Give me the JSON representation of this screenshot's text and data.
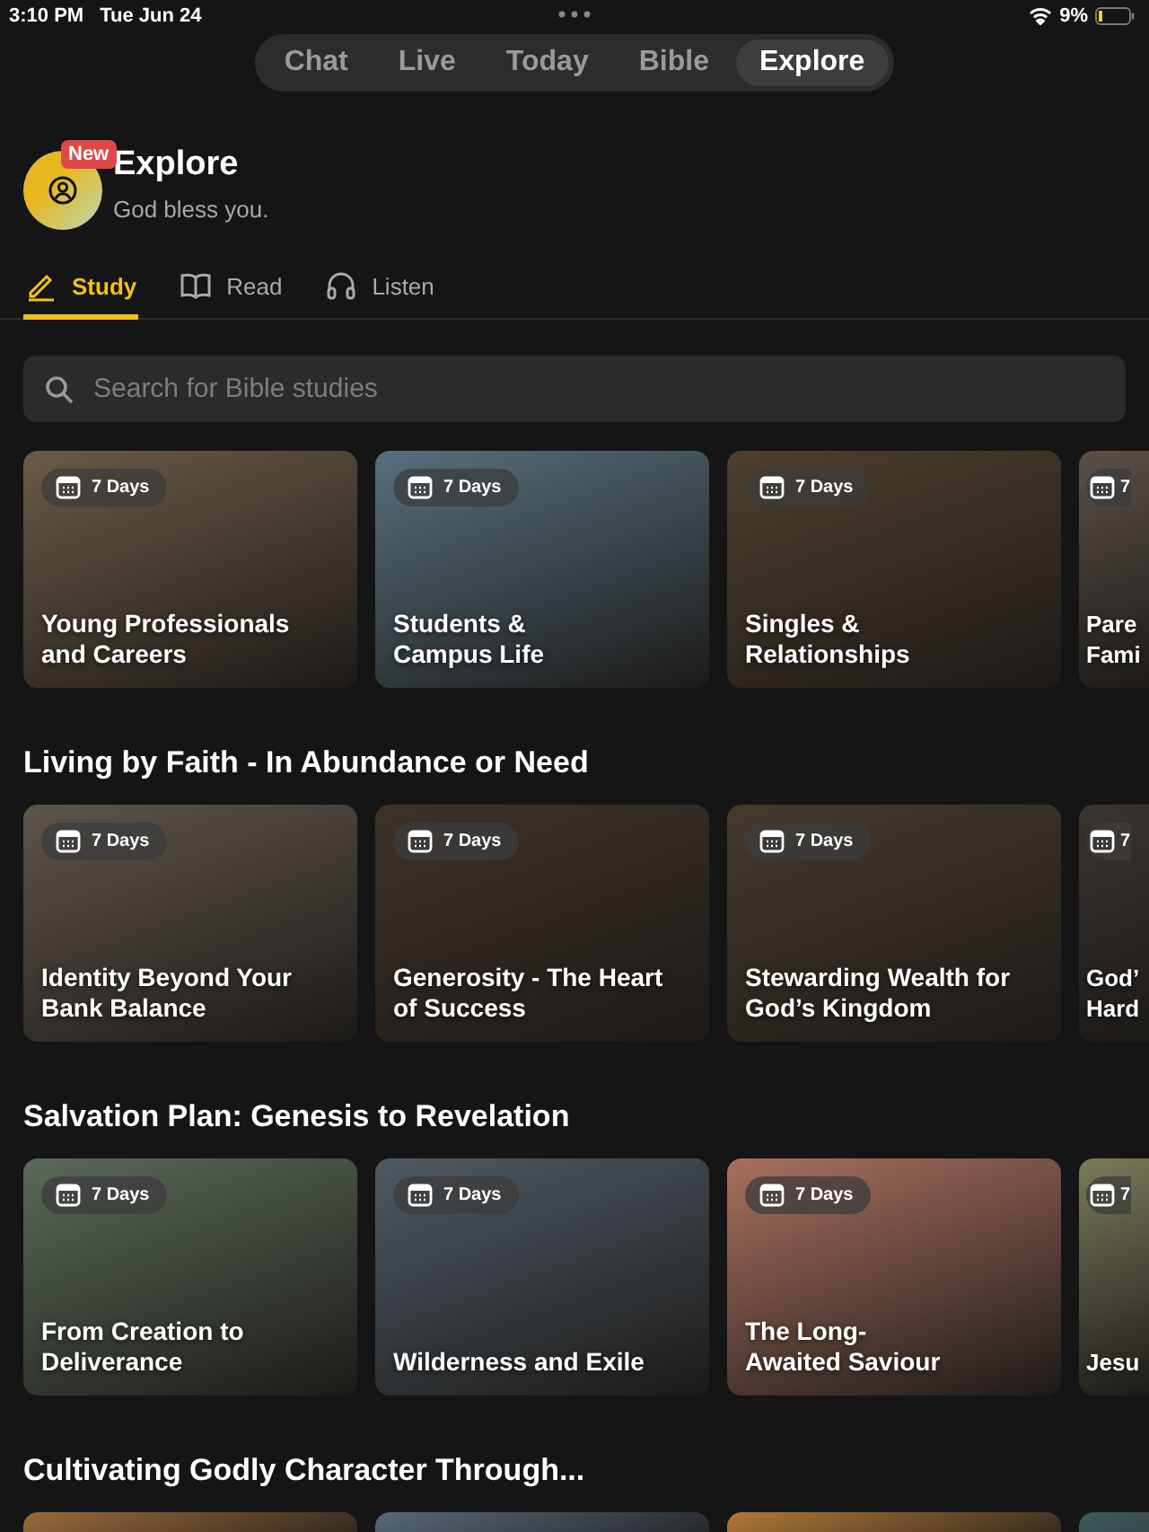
{
  "status_bar": {
    "time": "3:10 PM",
    "date": "Tue Jun 24",
    "battery": "9%"
  },
  "nav_tabs": [
    {
      "label": "Chat",
      "selected": false
    },
    {
      "label": "Live",
      "selected": false
    },
    {
      "label": "Today",
      "selected": false
    },
    {
      "label": "Bible",
      "selected": false
    },
    {
      "label": "Explore",
      "selected": true
    }
  ],
  "header": {
    "badge": "New",
    "title": "Explore",
    "subtitle": "God bless you."
  },
  "content_tabs": [
    {
      "label": "Study",
      "kind": "pencil",
      "selected": true
    },
    {
      "label": "Read",
      "kind": "book",
      "selected": false
    },
    {
      "label": "Listen",
      "kind": "headphones",
      "selected": false
    }
  ],
  "search": {
    "placeholder": "Search for Bible studies"
  },
  "sections": [
    {
      "cards": [
        {
          "kind": "full",
          "badge": "7 Days",
          "title": "Young Professionals\nand Careers",
          "color": "#6b5a45"
        },
        {
          "kind": "full",
          "badge": "7 Days",
          "title": "Students &\nCampus Life",
          "color": "#56707e"
        },
        {
          "kind": "full",
          "badge": "7 Days",
          "title": "Singles &\nRelationships",
          "color": "#4e3f2c"
        },
        {
          "kind": "cut",
          "badge": "7",
          "title": "Pare\nFami",
          "color": "#5a5048"
        }
      ]
    },
    {
      "title": "Living by Faith - In Abundance or Need",
      "cards": [
        {
          "kind": "full",
          "badge": "7 Days",
          "title": "Identity Beyond Your\nBank Balance",
          "color": "#5e554a"
        },
        {
          "kind": "full",
          "badge": "7 Days",
          "title": "Generosity - The Heart\nof Success",
          "color": "#3e3228"
        },
        {
          "kind": "full",
          "badge": "7 Days",
          "title": "Stewarding Wealth for\nGod’s Kingdom",
          "color": "#463a2c"
        },
        {
          "kind": "cut",
          "badge": "7",
          "title": "God’\nHard",
          "color": "#3a3430"
        }
      ]
    },
    {
      "title": "Salvation Plan: Genesis to Revelation",
      "cards": [
        {
          "kind": "full",
          "badge": "7 Days",
          "title": "From Creation to\nDeliverance",
          "color": "#5a6a58"
        },
        {
          "kind": "full",
          "badge": "7 Days",
          "title": "Wilderness and Exile",
          "color": "#4e5a64"
        },
        {
          "kind": "full",
          "badge": "7 Days",
          "title": "The Long-\nAwaited Saviour",
          "color": "#a8705e"
        },
        {
          "kind": "cut",
          "badge": "7",
          "title": "Jesu",
          "color": "#7a7a5a"
        }
      ]
    },
    {
      "title": "Cultivating Godly Character Through...",
      "cards": [
        {
          "kind": "top",
          "color": "#9a6a3a"
        },
        {
          "kind": "top",
          "color": "#56687a"
        },
        {
          "kind": "top",
          "color": "#b07838"
        },
        {
          "kind": "top",
          "color": "#3e5c5c"
        }
      ]
    }
  ]
}
